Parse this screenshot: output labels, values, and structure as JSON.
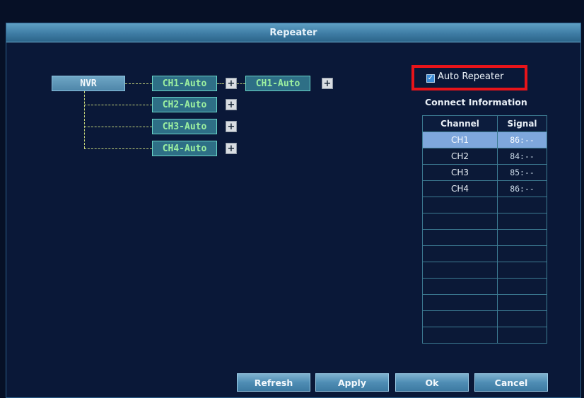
{
  "window": {
    "title": "Repeater"
  },
  "topology": {
    "root": "NVR",
    "branches": [
      {
        "label": "CH1-Auto",
        "plus": "+",
        "child": {
          "label": "CH1-Auto",
          "plus": "+"
        }
      },
      {
        "label": "CH2-Auto",
        "plus": "+"
      },
      {
        "label": "CH3-Auto",
        "plus": "+"
      },
      {
        "label": "CH4-Auto",
        "plus": "+"
      }
    ]
  },
  "auto_repeater": {
    "label": "Auto Repeater",
    "checked": true,
    "check_mark": "✓"
  },
  "connect_info": {
    "title": "Connect Information",
    "columns": [
      "Channel",
      "Signal"
    ],
    "rows": [
      {
        "channel": "CH1",
        "signal": "86:--",
        "selected": true
      },
      {
        "channel": "CH2",
        "signal": "84:--",
        "selected": false
      },
      {
        "channel": "CH3",
        "signal": "85:--",
        "selected": false
      },
      {
        "channel": "CH4",
        "signal": "86:--",
        "selected": false
      }
    ],
    "empty_rows": 9
  },
  "buttons": {
    "refresh": "Refresh",
    "apply": "Apply",
    "ok": "Ok",
    "cancel": "Cancel"
  },
  "colors": {
    "highlight_box": "#e8141a",
    "selected_row": "#7ea7dc",
    "channel_text": "#9cf0a0"
  }
}
